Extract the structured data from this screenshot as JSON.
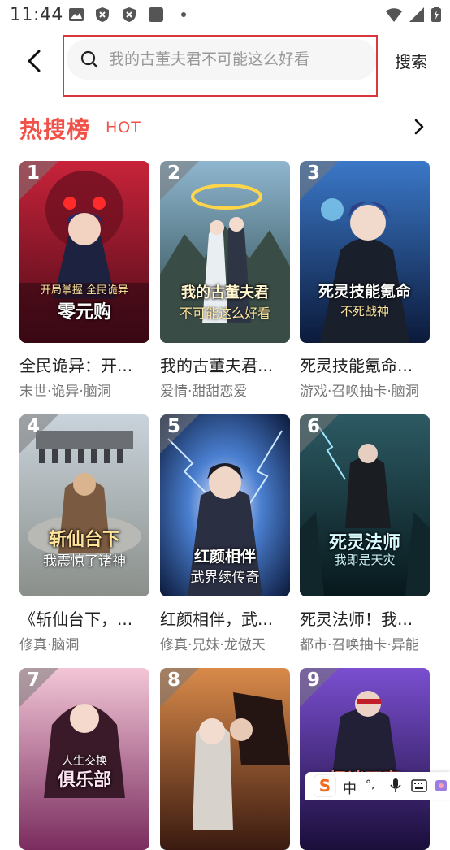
{
  "status_bar": {
    "time": "11:44"
  },
  "search": {
    "placeholder": "我的古董夫君不可能这么好看",
    "value": "",
    "button_label": "搜索"
  },
  "section": {
    "title": "热搜榜",
    "subtitle": "HOT"
  },
  "colors": {
    "accent": "#f0524a",
    "highlight_box": "#d9363e"
  },
  "books": [
    {
      "rank": "1",
      "title": "全民诡异：开...",
      "tags": "末世·诡异·脑洞",
      "cover_text": "零元购",
      "cover_sub": "开局掌握 全民诡异"
    },
    {
      "rank": "2",
      "title": "我的古董夫君...",
      "tags": "爱情·甜甜恋爱",
      "cover_text": "我的古董夫君",
      "cover_sub": "不可能这么好看"
    },
    {
      "rank": "3",
      "title": "死灵技能氪命...",
      "tags": "游戏·召唤抽卡·脑洞",
      "cover_text": "死灵技能氪命",
      "cover_sub": "不死战神"
    },
    {
      "rank": "4",
      "title": "《斩仙台下，...",
      "tags": "修真·脑洞",
      "cover_text": "斩仙台下",
      "cover_sub": "我震惊了诸神"
    },
    {
      "rank": "5",
      "title": "红颜相伴，武...",
      "tags": "修真·兄妹·龙傲天",
      "cover_text": "红颜相伴",
      "cover_sub": "武界续传奇"
    },
    {
      "rank": "6",
      "title": "死灵法师！我...",
      "tags": "都市·召唤抽卡·异能",
      "cover_text": "死灵法师",
      "cover_sub": "我即是天灾"
    },
    {
      "rank": "7",
      "title": "",
      "tags": "",
      "cover_text": "俱乐部",
      "cover_sub": "人生交换"
    },
    {
      "rank": "8",
      "title": "",
      "tags": "",
      "cover_text": "",
      "cover_sub": ""
    },
    {
      "rank": "9",
      "title": "",
      "tags": "",
      "cover_text": "怪谈玩家",
      "cover_sub": ""
    }
  ],
  "ime_toolbar": {
    "logo": "S",
    "lang": "中",
    "punct": "°,"
  }
}
